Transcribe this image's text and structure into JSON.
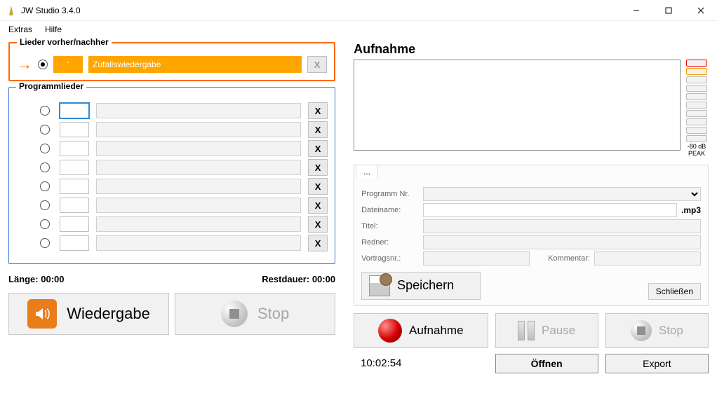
{
  "window": {
    "title": "JW Studio 3.4.0"
  },
  "menu": {
    "extras": "Extras",
    "help": "Hilfe"
  },
  "before_after": {
    "legend": "Lieder vorher/nachher",
    "number": "-",
    "title": "Zufallswiedergabe",
    "clear": "X"
  },
  "program": {
    "legend": "Programmlieder",
    "rows": [
      {
        "nr": "",
        "title": ""
      },
      {
        "nr": "",
        "title": ""
      },
      {
        "nr": "",
        "title": ""
      },
      {
        "nr": "",
        "title": ""
      },
      {
        "nr": "",
        "title": ""
      },
      {
        "nr": "",
        "title": ""
      },
      {
        "nr": "",
        "title": ""
      },
      {
        "nr": "",
        "title": ""
      }
    ],
    "clear": "X"
  },
  "length": {
    "label": "Länge:",
    "value": "00:00"
  },
  "remaining": {
    "label": "Restdauer:",
    "value": "00:00"
  },
  "playback": {
    "play": "Wiedergabe",
    "stop": "Stop"
  },
  "recording": {
    "header": "Aufnahme",
    "meter_caption": "-80 dB\nPEAK",
    "tab_label": "...",
    "fields": {
      "program_nr": "Programm Nr.",
      "filename": "Dateiname:",
      "ext": ".mp3",
      "title": "Titel:",
      "speaker": "Redner:",
      "talk_nr": "Vortragsnr.:",
      "comment": "Kommentar:"
    },
    "save": "Speichern",
    "close": "Schließen",
    "record": "Aufnahme",
    "pause": "Pause",
    "stop": "Stop",
    "clock": "10:02:54",
    "open": "Öffnen",
    "export": "Export"
  }
}
